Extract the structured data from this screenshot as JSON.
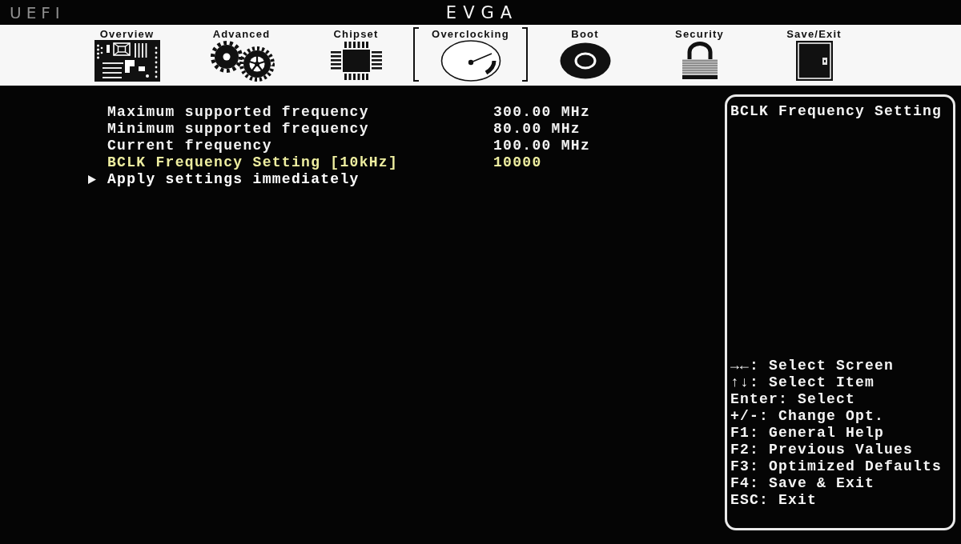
{
  "header": {
    "logo": "UEFI",
    "brand": "EVGA"
  },
  "tabs": [
    {
      "label": "Overview",
      "kind": "overview",
      "selected": false
    },
    {
      "label": "Advanced",
      "kind": "advanced",
      "selected": false
    },
    {
      "label": "Chipset",
      "kind": "chipset",
      "selected": false
    },
    {
      "label": "Overclocking",
      "kind": "overclocking",
      "selected": true
    },
    {
      "label": "Boot",
      "kind": "boot",
      "selected": false
    },
    {
      "label": "Security",
      "kind": "security",
      "selected": false
    },
    {
      "label": "Save/Exit",
      "kind": "exit",
      "selected": false
    }
  ],
  "settings": [
    {
      "kind": "value",
      "label": "Maximum supported frequency",
      "value": "300.00 MHz",
      "selected": false
    },
    {
      "kind": "value",
      "label": "Minimum supported frequency",
      "value": "80.00 MHz",
      "selected": false
    },
    {
      "kind": "value",
      "label": "Current frequency",
      "value": "100.00 MHz",
      "selected": false
    },
    {
      "kind": "value",
      "label": "BCLK Frequency Setting [10kHz]",
      "value": "10000",
      "selected": true
    },
    {
      "kind": "submenu",
      "label": "Apply settings immediately",
      "selected": false
    }
  ],
  "help": {
    "title": "BCLK Frequency Setting",
    "keys": [
      "→←: Select Screen",
      "↑↓: Select Item",
      "Enter: Select",
      "+/-: Change Opt.",
      "F1: General Help",
      "F2: Previous Values",
      "F3: Optimized Defaults",
      "F4: Save & Exit",
      "ESC: Exit"
    ]
  }
}
